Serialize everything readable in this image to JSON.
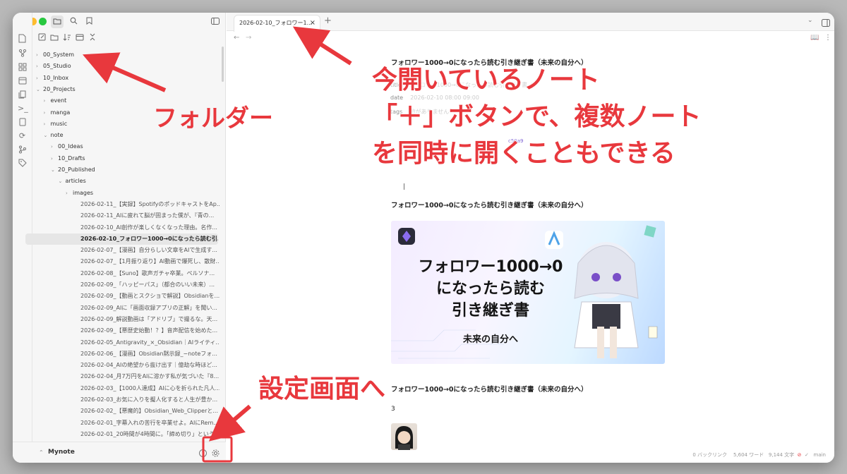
{
  "colors": {
    "annotation": "#e8383d",
    "banner_title": "#141414"
  },
  "tab": {
    "title": "2026-02-10_フォロワー1...",
    "close": "×",
    "add": "+"
  },
  "sidebar": {
    "tree": [
      {
        "label": "00_System",
        "type": "folder",
        "open": false,
        "depth": 0
      },
      {
        "label": "05_Studio",
        "type": "folder",
        "open": false,
        "depth": 0
      },
      {
        "label": "10_Inbox",
        "type": "folder",
        "open": false,
        "depth": 0
      },
      {
        "label": "20_Projects",
        "type": "folder",
        "open": true,
        "depth": 0
      },
      {
        "label": "event",
        "type": "folder",
        "open": false,
        "depth": 1
      },
      {
        "label": "manga",
        "type": "folder",
        "open": false,
        "depth": 1
      },
      {
        "label": "music",
        "type": "folder",
        "open": false,
        "depth": 1
      },
      {
        "label": "note",
        "type": "folder",
        "open": true,
        "depth": 1
      },
      {
        "label": "00_Ideas",
        "type": "folder",
        "open": false,
        "depth": 2
      },
      {
        "label": "10_Drafts",
        "type": "folder",
        "open": false,
        "depth": 2
      },
      {
        "label": "20_Published",
        "type": "folder",
        "open": true,
        "depth": 2
      },
      {
        "label": "articles",
        "type": "folder",
        "open": true,
        "depth": 3
      },
      {
        "label": "images",
        "type": "folder",
        "open": false,
        "depth": 4
      },
      {
        "label": "2026-02-11_【実録】Spotifyのポッドキャストを​Ap...",
        "type": "file",
        "depth": 4
      },
      {
        "label": "2026-02-11_AIに疲れて脳が固まった僕が、『青の...",
        "type": "file",
        "depth": 4
      },
      {
        "label": "2026-02-10_AI創作が楽しくなくなった理由。名作...",
        "type": "file",
        "depth": 4
      },
      {
        "label": "2026-02-10_フォロワー1000→0になったら読む引...",
        "type": "file",
        "depth": 4,
        "active": true
      },
      {
        "label": "2026-02-07_【漫画】自分らしい文章をAIで生成す...",
        "type": "file",
        "depth": 4
      },
      {
        "label": "2026-02-07_【1月振り返り】AI動画で爆死し、散財...",
        "type": "file",
        "depth": 4
      },
      {
        "label": "2026-02-08_【Suno】歌声ガチャ卒業。ペルソナ...",
        "type": "file",
        "depth": 4
      },
      {
        "label": "2026-02-09_「ハッピーパス」（都合のいい未来）...",
        "type": "file",
        "depth": 4
      },
      {
        "label": "2026-02-09_【動画とスクショで解説】Obsidianを...",
        "type": "file",
        "depth": 4
      },
      {
        "label": "2026-02-09_AIに「画面収録アプリの正解」を聞い...",
        "type": "file",
        "depth": 4
      },
      {
        "label": "2026-02-09_解説動画は「アドリブ」で撮るな。天...",
        "type": "file",
        "depth": 4
      },
      {
        "label": "2026-02-09_【悪歴史始動！？】音声配信を始めた...",
        "type": "file",
        "depth": 4
      },
      {
        "label": "2026-02-05_Antigravity_×_Obsidian｜AIライティ...",
        "type": "file",
        "depth": 4
      },
      {
        "label": "2026-02-06_【漫画】Obsidian黙示録_−noteフォ...",
        "type": "file",
        "depth": 4
      },
      {
        "label": "2026-02-04_AIの絶望から抜け出す｜億劫な時ほど...",
        "type": "file",
        "depth": 4
      },
      {
        "label": "2026-02-04_月7万円をAIに溶かす私が気づいた『8...",
        "type": "file",
        "depth": 4
      },
      {
        "label": "2026-02-03_【1000人達成】AIに心を折られた凡人...",
        "type": "file",
        "depth": 4
      },
      {
        "label": "2026-02-03_お気に入りを擬人化すると人生が豊か...",
        "type": "file",
        "depth": 4
      },
      {
        "label": "2026-02-02_【悪魔的】Obsidian_Web_Clipperと...",
        "type": "file",
        "depth": 4
      },
      {
        "label": "2026-02-01_字幕入れの苦行を卒業せよ。AIにRem...",
        "type": "file",
        "depth": 4
      },
      {
        "label": "2026-02-01_20時間が4時間に。「締め切り」という...",
        "type": "file",
        "depth": 4
      }
    ],
    "vault_name": "Mynote"
  },
  "note": {
    "title_partial": "フォロワー1000→0になったら読む引き継ぎ書（未来の自分へ）",
    "props": [
      {
        "key": "title",
        "value": "フォロワー1000→0になったら読む引き継ぎ書（"
      },
      {
        "key": "date",
        "value": "2026-02-10 08:00 09:00"
      },
      {
        "key": "tags",
        "value": "値がありません"
      }
    ],
    "link_fragment": "c50a9",
    "cursor": "|",
    "heading1": "フォロワー1000→0になったら読む引き継ぎ書（未来の自分へ）",
    "banner_line1": "フォロワー1000→0",
    "banner_line2": "になったら読む",
    "banner_line3": "引き継ぎ書",
    "banner_sub": "未来の自分へ",
    "heading2": "フォロワー1000→0になったら読む引き継ぎ書（未来の自分へ）",
    "number": "3"
  },
  "status_bar": {
    "backlinks": "0 バックリンク",
    "words": "5,604 ワード",
    "chars": "9,144 文字",
    "branch": "main"
  },
  "annotations": {
    "folder": "フォルダー",
    "tab_line1": "今開いているノート",
    "tab_line2": "「＋」ボタンで、複数ノート",
    "tab_line3": "を同時に開くこともできる",
    "settings": "設定画面へ"
  }
}
